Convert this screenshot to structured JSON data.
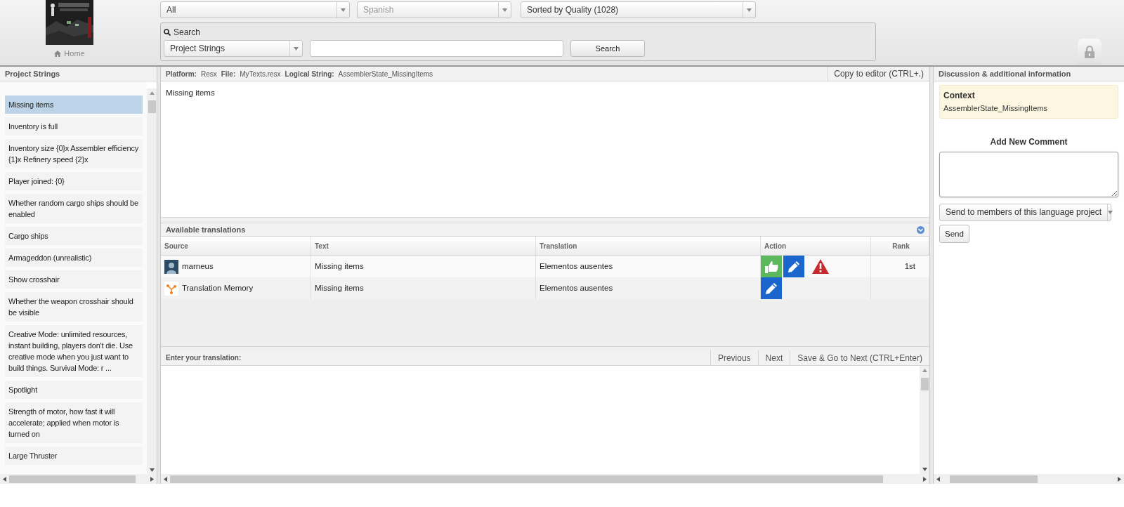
{
  "header": {
    "home_link": "Home",
    "filters": [
      {
        "value": "All",
        "disabled": false
      },
      {
        "value": "Spanish",
        "disabled": true
      },
      {
        "value": "Sorted by Quality (1028)",
        "disabled": false
      }
    ],
    "search": {
      "label": "Search",
      "scope": "Project Strings",
      "button": "Search"
    }
  },
  "strings_panel": {
    "title": "Project Strings",
    "items": [
      {
        "text": "Missing items",
        "selected": true
      },
      {
        "text": "Inventory is full",
        "selected": false
      },
      {
        "text": "Inventory size {0}x Assembler efficiency {1}x Refinery speed {2}x",
        "selected": false
      },
      {
        "text": "Player joined: {0}",
        "selected": false
      },
      {
        "text": "Whether random cargo ships should be enabled",
        "selected": false
      },
      {
        "text": "Cargo ships",
        "selected": false
      },
      {
        "text": "Armageddon (unrealistic)",
        "selected": false
      },
      {
        "text": "Show crosshair",
        "selected": false
      },
      {
        "text": "Whether the weapon crosshair should be visible",
        "selected": false
      },
      {
        "text": "Creative Mode: unlimited resources, instant building, players don't die. Use creative mode when you just want to build things. Survival Mode: r ...",
        "selected": false
      },
      {
        "text": "Spotlight",
        "selected": false
      },
      {
        "text": "Strength of motor, how fast it will accelerate; applied when motor is turned on",
        "selected": false
      },
      {
        "text": "Large Thruster",
        "selected": false
      }
    ]
  },
  "editor": {
    "info": [
      {
        "label": "Platform:",
        "value": "Resx"
      },
      {
        "label": "File:",
        "value": "MyTexts.resx"
      },
      {
        "label": "Logical String:",
        "value": "AssemblerState_MissingItems"
      }
    ],
    "copy_button": "Copy to editor (CTRL+.)",
    "source_text": "Missing items",
    "translations": {
      "title": "Available translations",
      "columns": [
        "Source",
        "Text",
        "Translation",
        "Action",
        "Rank"
      ],
      "rows": [
        {
          "kind": "user",
          "source": "marneus",
          "text": "Missing items",
          "translation": "Elementos ausentes",
          "actions": [
            {
              "kind": "approve"
            },
            {
              "kind": "edit"
            },
            {
              "kind": "report"
            }
          ],
          "rank": "1st"
        },
        {
          "kind": "memory",
          "source": "Translation Memory",
          "text": "Missing items",
          "translation": "Elementos ausentes",
          "actions": [
            {
              "kind": "edit"
            }
          ]
        }
      ]
    },
    "input_label": "Enter your translation:",
    "buttons": [
      "Previous",
      "Next",
      "Save & Go to Next (CTRL+Enter)"
    ]
  },
  "discussion": {
    "title": "Discussion & additional information",
    "context": {
      "title": "Context",
      "value": "AssemblerState_MissingItems"
    },
    "comment_heading": "Add New Comment",
    "recipients": "Send to members of this language project",
    "send_button": "Send"
  }
}
